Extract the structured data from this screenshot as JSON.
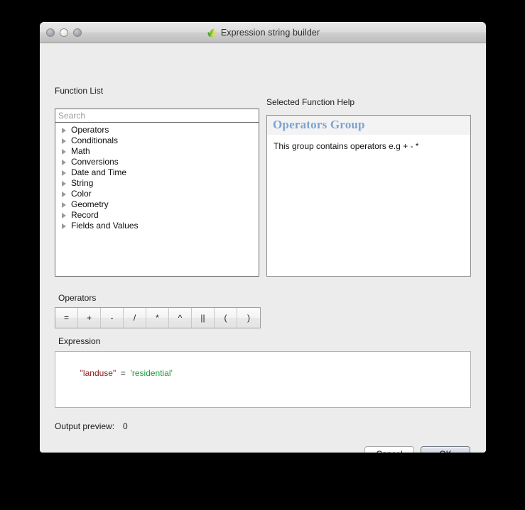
{
  "window": {
    "title": "Expression string builder",
    "app_icon": "qgis-leaf-icon",
    "controls": {
      "close": "close-button",
      "minimize": "minimize-button",
      "zoom": "zoom-button"
    }
  },
  "function_list": {
    "label": "Function List",
    "search_placeholder": "Search",
    "search_value": "",
    "items": [
      {
        "label": "Operators"
      },
      {
        "label": "Conditionals"
      },
      {
        "label": "Math"
      },
      {
        "label": "Conversions"
      },
      {
        "label": "Date and Time"
      },
      {
        "label": "String"
      },
      {
        "label": "Color"
      },
      {
        "label": "Geometry"
      },
      {
        "label": "Record"
      },
      {
        "label": "Fields and Values"
      }
    ]
  },
  "help": {
    "label": "Selected Function Help",
    "title": "Operators Group",
    "body": "This group contains operators e.g + - *",
    "title_color": "#7ba3d0"
  },
  "operators": {
    "label": "Operators",
    "buttons": [
      "=",
      "+",
      "-",
      "/",
      "*",
      "^",
      "||",
      "(",
      ")"
    ]
  },
  "expression": {
    "label": "Expression",
    "tokens": [
      {
        "text": "\"landuse\"",
        "kind": "field",
        "color": "#8b1a1a"
      },
      {
        "text": "  =  ",
        "kind": "operator",
        "color": "#111111"
      },
      {
        "text": "'residential'",
        "kind": "string",
        "color": "#1e9a3c"
      }
    ],
    "plain": "\"landuse\"  =  'residential'"
  },
  "output_preview": {
    "label": "Output preview:",
    "value": "0"
  },
  "footer": {
    "cancel_label": "Cancel",
    "ok_label": "OK"
  }
}
